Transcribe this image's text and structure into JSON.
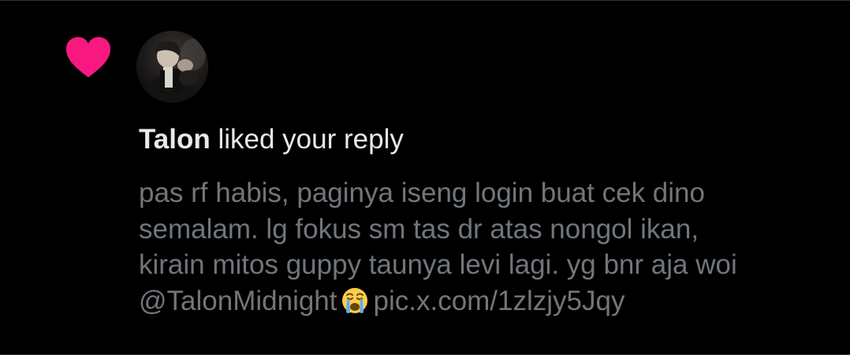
{
  "notification": {
    "type_icon": "heart-icon",
    "avatar_icon": "user-avatar-photo",
    "user_name": "Talon",
    "action_text": "liked your reply",
    "reply": {
      "lines": [
        "pas rf habis, paginya iseng login buat cek dino",
        "semalam. lg fokus sm tas dr atas nongol ikan,",
        "kirain mitos guppy taunya levi lagi. yg bnr aja woi"
      ],
      "mention": "@TalonMidnight",
      "emoji_icon": "loudly-crying-face-icon",
      "link": "pic.x.com/1zlzjy5Jqy"
    }
  },
  "colors": {
    "background": "#000000",
    "heart": "#f91880",
    "primary_text": "#e7e9ea",
    "secondary_text": "#71767b",
    "border": "#2f3336"
  }
}
